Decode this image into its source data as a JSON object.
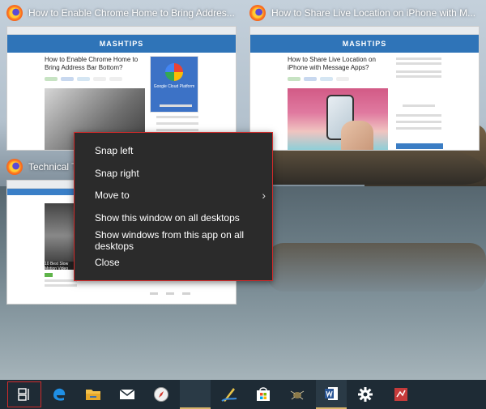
{
  "windows": [
    {
      "title": "How to Enable Chrome Home to Bring Addres...",
      "thumb": {
        "site": "MASHTIPS",
        "headline": "How to Enable Chrome Home to Bring Address Bar Bottom?",
        "side_label": "Google Cloud Platform"
      }
    },
    {
      "title": "How to Share Live Location on iPhone with M...",
      "thumb": {
        "site": "MASHTIPS",
        "headline": "How to Share Live Location on iPhone with Message Apps?"
      }
    },
    {
      "title": "Technical Tip",
      "thumb": {
        "headline": "10 Best Slow Motion Video Apps for Android"
      }
    }
  ],
  "context_menu": {
    "items": [
      {
        "label": "Snap left"
      },
      {
        "label": "Snap right"
      },
      {
        "label": "Move to",
        "submenu": true
      },
      {
        "label": "Show this window on all desktops"
      },
      {
        "label": "Show windows from this app on all desktops"
      },
      {
        "label": "Close"
      }
    ],
    "submenu_glyph": "›",
    "border_color": "#d12b2b"
  },
  "taskbar": {
    "icons": [
      "task-view-icon",
      "edge-icon",
      "file-explorer-icon",
      "mail-icon",
      "safari-compass-icon",
      "firefox-icon",
      "pen-app-icon",
      "store-icon",
      "bug-app-icon",
      "word-icon",
      "settings-gear-icon",
      "red-app-icon"
    ],
    "active_indicator_color": "#d7b46a"
  }
}
